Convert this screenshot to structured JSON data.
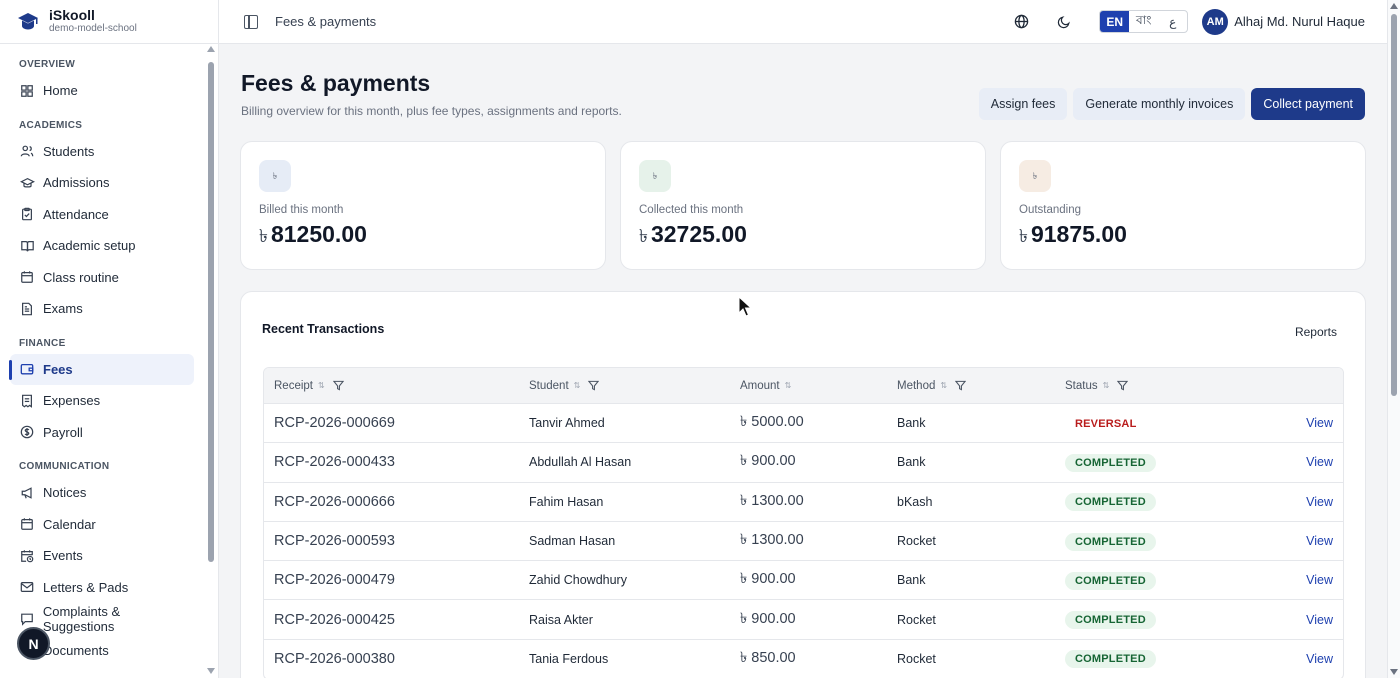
{
  "brand": {
    "name": "iSkooll",
    "sub": "demo-model-school"
  },
  "sidebar": {
    "sections": [
      {
        "title": "OVERVIEW",
        "items": [
          {
            "label": "Home",
            "icon": "grid-icon"
          }
        ]
      },
      {
        "title": "ACADEMICS",
        "items": [
          {
            "label": "Students",
            "icon": "users-icon"
          },
          {
            "label": "Admissions",
            "icon": "graduation-cap-icon"
          },
          {
            "label": "Attendance",
            "icon": "clipboard-check-icon"
          },
          {
            "label": "Academic setup",
            "icon": "book-open-icon"
          },
          {
            "label": "Class routine",
            "icon": "calendar-icon"
          },
          {
            "label": "Exams",
            "icon": "file-text-icon"
          }
        ]
      },
      {
        "title": "FINANCE",
        "items": [
          {
            "label": "Fees",
            "icon": "wallet-icon",
            "active": true
          },
          {
            "label": "Expenses",
            "icon": "receipt-icon"
          },
          {
            "label": "Payroll",
            "icon": "dollar-circle-icon"
          }
        ]
      },
      {
        "title": "COMMUNICATION",
        "items": [
          {
            "label": "Notices",
            "icon": "megaphone-icon"
          },
          {
            "label": "Calendar",
            "icon": "calendar-icon"
          },
          {
            "label": "Events",
            "icon": "calendar-clock-icon"
          },
          {
            "label": "Letters & Pads",
            "icon": "mail-icon"
          },
          {
            "label": "Complaints & Suggestions",
            "icon": "message-icon"
          },
          {
            "label": "Documents",
            "icon": "stamp-icon"
          }
        ]
      }
    ],
    "badge": "N"
  },
  "topbar": {
    "breadcrumb": "Fees & payments",
    "languages": [
      "EN",
      "বাং",
      "ع"
    ],
    "active_language": "EN",
    "avatar_initials": "AM",
    "user_name": "Alhaj Md. Nurul Haque"
  },
  "page": {
    "title": "Fees & payments",
    "subtitle": "Billing overview for this month, plus fee types, assignments and reports.",
    "actions": {
      "assign_fees": "Assign fees",
      "generate_invoices": "Generate monthly invoices",
      "collect_payment": "Collect payment"
    }
  },
  "stats": [
    {
      "label": "Billed this month",
      "currency": "৳",
      "value": "81250.00",
      "icon_bg": "#e6ecf6"
    },
    {
      "label": "Collected this month",
      "currency": "৳",
      "value": "32725.00",
      "icon_bg": "#e6f2ea"
    },
    {
      "label": "Outstanding",
      "currency": "৳",
      "value": "91875.00",
      "icon_bg": "#f6ece3"
    }
  ],
  "transactions": {
    "title": "Recent Transactions",
    "reports_link": "Reports",
    "columns": {
      "receipt": "Receipt",
      "student": "Student",
      "amount": "Amount",
      "method": "Method",
      "status": "Status"
    },
    "rows": [
      {
        "receipt": "RCP-2026-000669",
        "student": "Tanvir Ahmed",
        "amount": "৳ 5000.00",
        "method": "Bank",
        "status": "REVERSAL",
        "action": "View"
      },
      {
        "receipt": "RCP-2026-000433",
        "student": "Abdullah Al Hasan",
        "amount": "৳ 900.00",
        "method": "Bank",
        "status": "COMPLETED",
        "action": "View"
      },
      {
        "receipt": "RCP-2026-000666",
        "student": "Fahim Hasan",
        "amount": "৳ 1300.00",
        "method": "bKash",
        "status": "COMPLETED",
        "action": "View"
      },
      {
        "receipt": "RCP-2026-000593",
        "student": "Sadman Hasan",
        "amount": "৳ 1300.00",
        "method": "Rocket",
        "status": "COMPLETED",
        "action": "View"
      },
      {
        "receipt": "RCP-2026-000479",
        "student": "Zahid Chowdhury",
        "amount": "৳ 900.00",
        "method": "Bank",
        "status": "COMPLETED",
        "action": "View"
      },
      {
        "receipt": "RCP-2026-000425",
        "student": "Raisa Akter",
        "amount": "৳ 900.00",
        "method": "Rocket",
        "status": "COMPLETED",
        "action": "View"
      },
      {
        "receipt": "RCP-2026-000380",
        "student": "Tania Ferdous",
        "amount": "৳ 850.00",
        "method": "Rocket",
        "status": "COMPLETED",
        "action": "View"
      }
    ]
  },
  "colors": {
    "primary": "#1e3a8a",
    "accent": "#1e40af",
    "completed": "#166534",
    "reversal": "#b91c1c"
  }
}
